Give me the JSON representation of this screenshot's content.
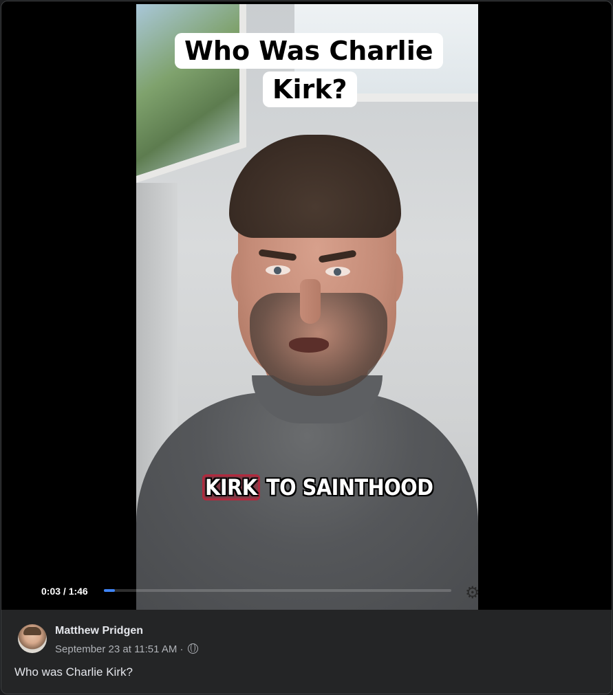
{
  "video": {
    "overlay_title_line1": "Who Was Charlie",
    "overlay_title_line2": "Kirk?",
    "caption_highlight": "KIRK",
    "caption_rest": " TO SAINTHOOD",
    "time_display": "0:03 / 1:46",
    "current_time_seconds": 3,
    "duration_seconds": 106,
    "progress_color": "#3f84f6"
  },
  "post": {
    "author": "Matthew Pridgen",
    "date": "September 23 at 11:51 AM",
    "separator": "·",
    "privacy_icon": "globe-icon",
    "text": "Who was Charlie Kirk?"
  }
}
